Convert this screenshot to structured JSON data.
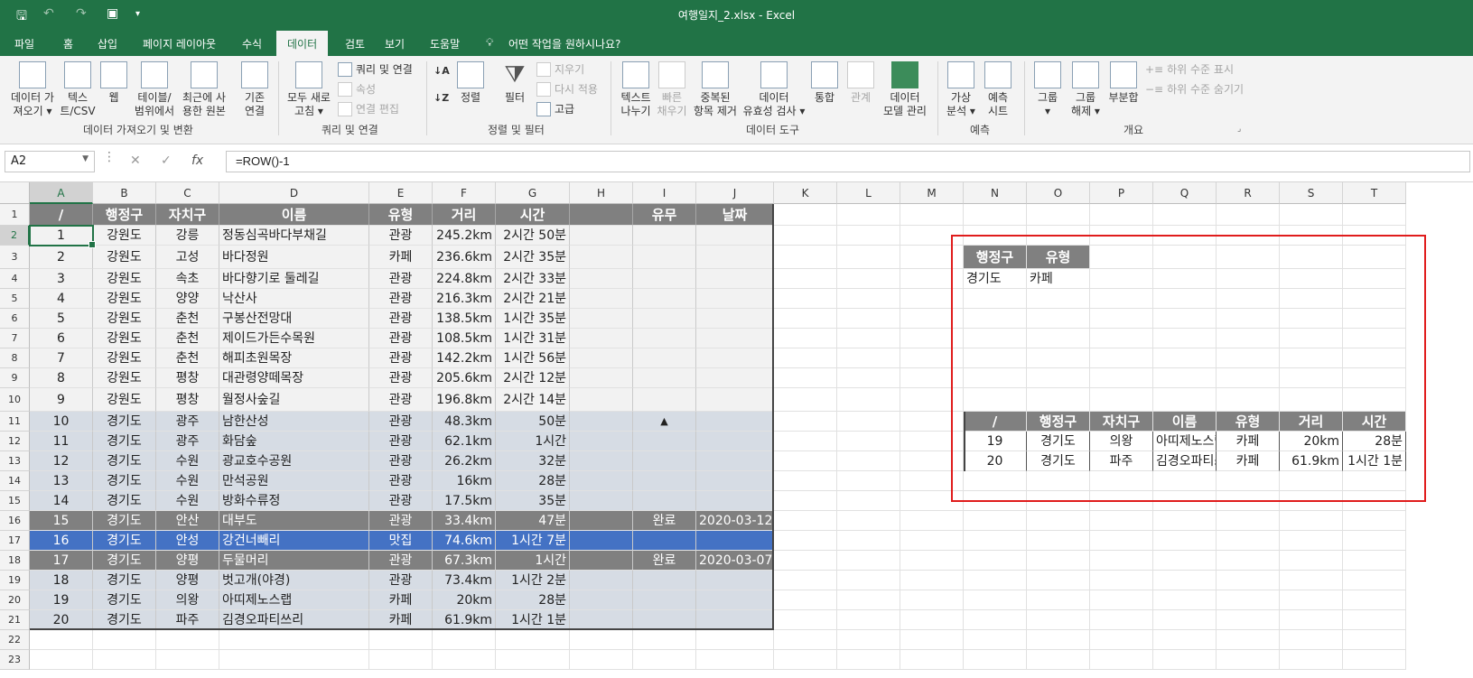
{
  "window": {
    "title": "여행일지_2.xlsx  -  Excel"
  },
  "quick_access": {
    "save_icon": "save-icon",
    "undo_icon": "undo-icon",
    "redo_icon": "redo-icon",
    "camera_icon": "camera-icon",
    "customize": "▾"
  },
  "tabs": [
    "파일",
    "홈",
    "삽입",
    "페이지 레이아웃",
    "수식",
    "데이터",
    "검토",
    "보기",
    "도움말"
  ],
  "active_tab": "데이터",
  "tellme": "어떤 작업을 원하시나요?",
  "ribbon": {
    "groups": {
      "get": "데이터 가져오기 및 변환",
      "queries": "쿼리 및 연결",
      "sort": "정렬 및 필터",
      "tools": "데이터 도구",
      "forecast": "예측",
      "outline": "개요"
    },
    "get_data": [
      "데이터 가",
      "져오기 ▾"
    ],
    "text_csv": [
      "텍스",
      "트/CSV"
    ],
    "web": "웹",
    "from_table": [
      "테이블/",
      "범위에서"
    ],
    "recent": [
      "최근에 사",
      "용한 원본"
    ],
    "existing": [
      "기존",
      "연결"
    ],
    "refresh_all": [
      "모두 새로",
      "고침 ▾"
    ],
    "queries_conn": "쿼리 및 연결",
    "properties": "속성",
    "edit_links": "연결 편집",
    "sort": "정렬",
    "filter": "필터",
    "clear": "지우기",
    "reapply": "다시 적용",
    "advanced": "고급",
    "text_to_col": [
      "텍스트",
      "나누기"
    ],
    "flash_fill": [
      "빠른",
      "채우기"
    ],
    "remove_dup": [
      "중복된",
      "항목 제거"
    ],
    "validation": [
      "데이터",
      "유효성 검사 ▾"
    ],
    "consolidate": "통합",
    "relations": "관계",
    "data_model": [
      "데이터",
      "모델 관리"
    ],
    "what_if": [
      "가상",
      "분석 ▾"
    ],
    "forecast_sheet": [
      "예측",
      "시트"
    ],
    "group": [
      "그룹",
      "▾"
    ],
    "ungroup": [
      "그룹",
      "해제 ▾"
    ],
    "subtotal": "부분합",
    "show_detail": "하위 수준 표시",
    "hide_detail": "하위 수준 숨기기"
  },
  "formula_bar": {
    "name_box": "A2",
    "formula": "=ROW()-1",
    "cancel": "✕",
    "enter": "✓",
    "fx": "fx"
  },
  "columns": [
    "A",
    "B",
    "C",
    "D",
    "E",
    "F",
    "G",
    "H",
    "I",
    "J",
    "K",
    "L",
    "M",
    "N",
    "O",
    "P",
    "Q",
    "R",
    "S",
    "T"
  ],
  "row_numbers": [
    "1",
    "2",
    "3",
    "4",
    "5",
    "6",
    "7",
    "8",
    "9",
    "10",
    "11",
    "12",
    "13",
    "14",
    "15",
    "16",
    "17",
    "18",
    "19",
    "20",
    "21",
    "22",
    "23"
  ],
  "table": {
    "headers": [
      "/",
      "행정구",
      "자치구",
      "이름",
      "유형",
      "거리",
      "시간",
      "",
      "유무",
      "날짜"
    ],
    "rows": [
      [
        "1",
        "강원도",
        "강릉",
        "정동심곡바다부채길",
        "관광",
        "245.2km",
        "2시간 50분",
        "",
        "",
        ""
      ],
      [
        "2",
        "강원도",
        "고성",
        "바다정원",
        "카페",
        "236.6km",
        "2시간 35분",
        "",
        "",
        ""
      ],
      [
        "3",
        "강원도",
        "속초",
        "바다향기로 둘레길",
        "관광",
        "224.8km",
        "2시간 33분",
        "",
        "",
        ""
      ],
      [
        "4",
        "강원도",
        "양양",
        "낙산사",
        "관광",
        "216.3km",
        "2시간 21분",
        "",
        "",
        ""
      ],
      [
        "5",
        "강원도",
        "춘천",
        "구봉산전망대",
        "관광",
        "138.5km",
        "1시간 35분",
        "",
        "",
        ""
      ],
      [
        "6",
        "강원도",
        "춘천",
        "제이드가든수목원",
        "관광",
        "108.5km",
        "1시간 31분",
        "",
        "",
        ""
      ],
      [
        "7",
        "강원도",
        "춘천",
        "해피초원목장",
        "관광",
        "142.2km",
        "1시간 56분",
        "",
        "",
        ""
      ],
      [
        "8",
        "강원도",
        "평창",
        "대관령양떼목장",
        "관광",
        "205.6km",
        "2시간 12분",
        "",
        "",
        ""
      ],
      [
        "9",
        "강원도",
        "평창",
        "월정사숲길",
        "관광",
        "196.8km",
        "2시간 14분",
        "",
        "",
        ""
      ],
      [
        "10",
        "경기도",
        "광주",
        "남한산성",
        "관광",
        "48.3km",
        "50분",
        "",
        "▲",
        ""
      ],
      [
        "11",
        "경기도",
        "광주",
        "화담숲",
        "관광",
        "62.1km",
        "1시간",
        "",
        "",
        ""
      ],
      [
        "12",
        "경기도",
        "수원",
        "광교호수공원",
        "관광",
        "26.2km",
        "32분",
        "",
        "",
        ""
      ],
      [
        "13",
        "경기도",
        "수원",
        "만석공원",
        "관광",
        "16km",
        "28분",
        "",
        "",
        ""
      ],
      [
        "14",
        "경기도",
        "수원",
        "방화수류정",
        "관광",
        "17.5km",
        "35분",
        "",
        "",
        ""
      ],
      [
        "15",
        "경기도",
        "안산",
        "대부도",
        "관광",
        "33.4km",
        "47분",
        "",
        "완료",
        "2020-03-12"
      ],
      [
        "16",
        "경기도",
        "안성",
        "강건너빼리",
        "맛집",
        "74.6km",
        "1시간 7분",
        "",
        "",
        ""
      ],
      [
        "17",
        "경기도",
        "양평",
        "두물머리",
        "관광",
        "67.3km",
        "1시간",
        "",
        "완료",
        "2020-03-07"
      ],
      [
        "18",
        "경기도",
        "양평",
        "벗고개(야경)",
        "관광",
        "73.4km",
        "1시간 2분",
        "",
        "",
        ""
      ],
      [
        "19",
        "경기도",
        "의왕",
        "아띠제노스랩",
        "카페",
        "20km",
        "28분",
        "",
        "",
        ""
      ],
      [
        "20",
        "경기도",
        "파주",
        "김경오파티쓰리",
        "카페",
        "61.9km",
        "1시간 1분",
        "",
        "",
        ""
      ]
    ]
  },
  "criteria": {
    "headers": [
      "행정구",
      "유형"
    ],
    "values": [
      "경기도",
      "카페"
    ]
  },
  "result": {
    "headers": [
      "/",
      "행정구",
      "자치구",
      "이름",
      "유형",
      "거리",
      "시간"
    ],
    "rows": [
      [
        "19",
        "경기도",
        "의왕",
        "아띠제노스랩",
        "카페",
        "20km",
        "28분"
      ],
      [
        "20",
        "경기도",
        "파주",
        "김경오파티쓰리",
        "카페",
        "61.9km",
        "1시간 1분"
      ]
    ]
  },
  "colors": {
    "excel_green": "#217346",
    "header_gray": "#808080",
    "gangwon": "#f2f2f2",
    "gyeonggi": "#d6dce4",
    "done_gray": "#808080",
    "selected_blue": "#4472c4",
    "red_box": "#e01c1c"
  }
}
